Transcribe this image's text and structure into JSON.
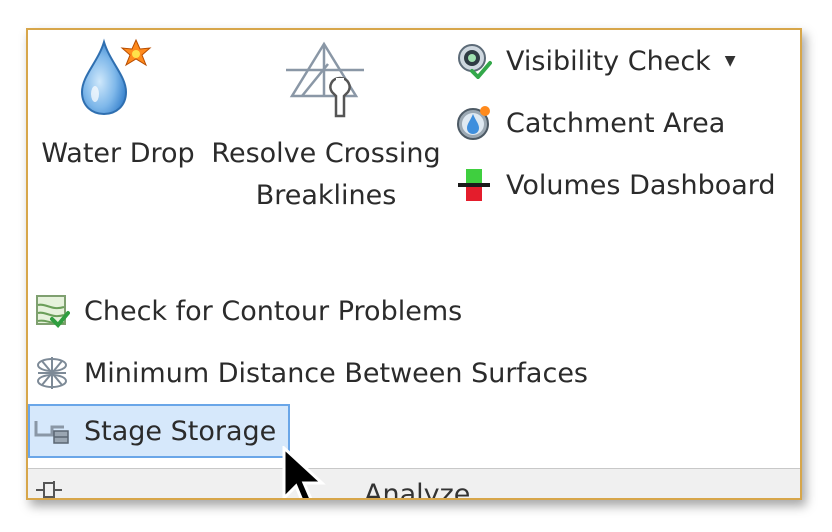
{
  "panel": {
    "title": "Analyze",
    "large_buttons": [
      {
        "label": "Water Drop",
        "icon": "water-drop-icon"
      },
      {
        "label_line1": "Resolve Crossing",
        "label_line2": "Breaklines",
        "icon": "resolve-crossing-breaklines-icon"
      }
    ],
    "right_items": [
      {
        "label": "Visibility Check",
        "icon": "visibility-check-icon",
        "has_dropdown": true
      },
      {
        "label": "Catchment Area",
        "icon": "catchment-area-icon"
      },
      {
        "label": "Volumes Dashboard",
        "icon": "volumes-dashboard-icon"
      }
    ],
    "list_items": [
      {
        "label": "Check for Contour Problems",
        "icon": "check-contour-problems-icon"
      },
      {
        "label": "Minimum Distance Between Surfaces",
        "icon": "minimum-distance-icon"
      },
      {
        "label": "Stage Storage",
        "icon": "stage-storage-icon",
        "highlighted": true
      }
    ]
  },
  "colors": {
    "frame_border": "#d7a64a",
    "highlight_fill": "#d6e8fb",
    "highlight_border": "#6aa6e8"
  }
}
